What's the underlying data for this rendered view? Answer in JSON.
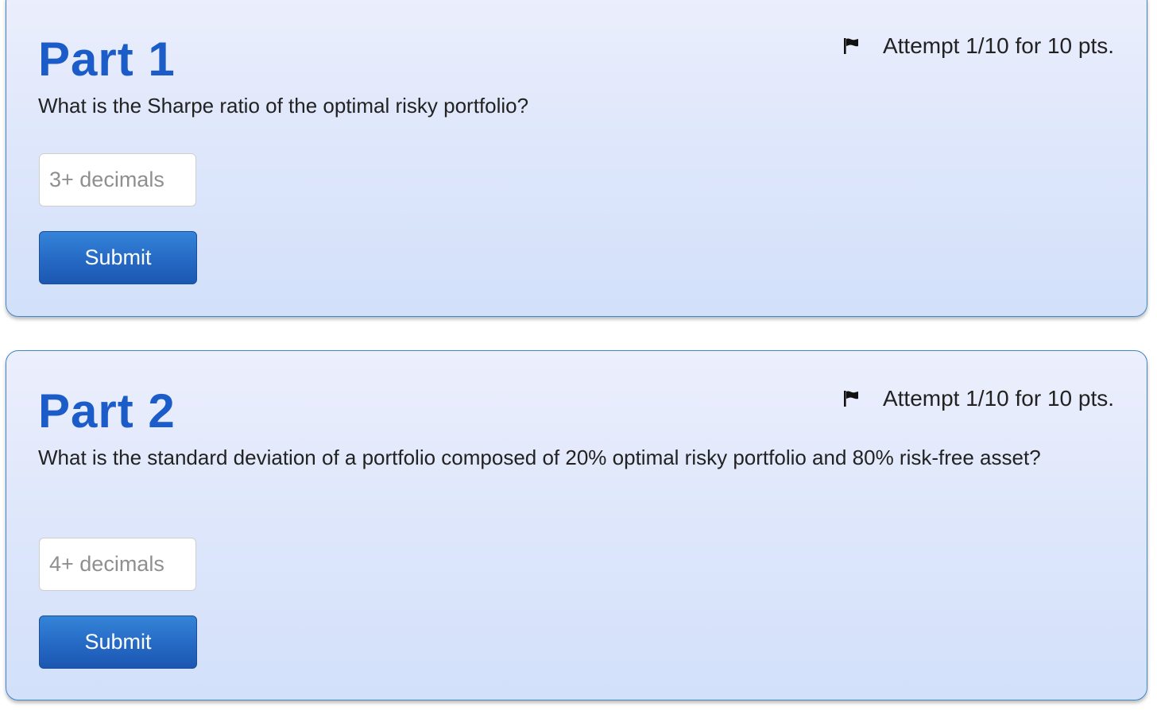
{
  "parts": [
    {
      "title": "Part 1",
      "attempt": "Attempt 1/10 for 10 pts.",
      "question": "What is the Sharpe ratio of the optimal risky portfolio?",
      "input_placeholder": "3+ decimals",
      "input_value": "",
      "submit_label": "Submit",
      "flag_icon": "flag-icon"
    },
    {
      "title": "Part 2",
      "attempt": "Attempt 1/10 for 10 pts.",
      "question": "What is the standard deviation of a portfolio composed of 20% optimal risky portfolio and 80% risk-free asset?",
      "input_placeholder": "4+ decimals",
      "input_value": "",
      "submit_label": "Submit",
      "flag_icon": "flag-icon"
    }
  ],
  "colors": {
    "title": "#1c5cc8",
    "panel_border": "#3f87c8",
    "button": "#2569c5"
  }
}
